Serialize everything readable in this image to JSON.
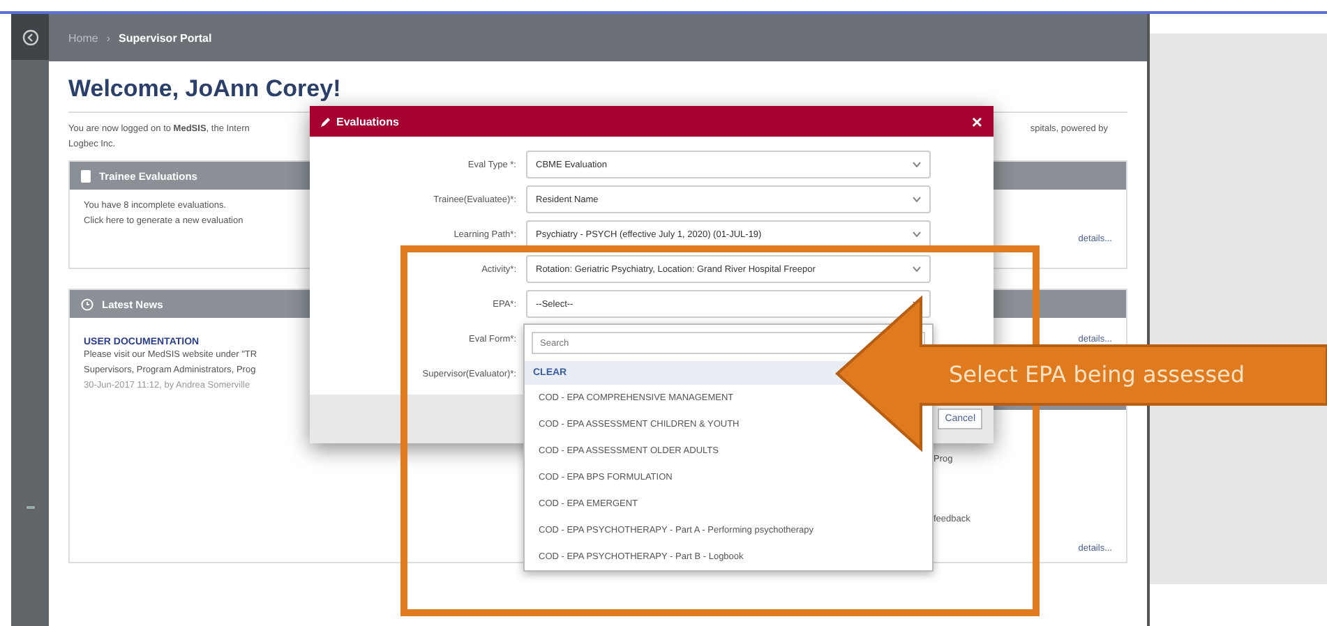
{
  "breadcrumb": [
    "Home",
    "Supervisor Portal"
  ],
  "breadcrumb_separator": "›",
  "welcome": "Welcome, JoAnn Corey!",
  "intro": {
    "left": "You are now logged on to **MedSIS**, the Intern",
    "right": "spitals, powered by",
    "second_line": "Logbec Inc."
  },
  "trainee_evaluations": {
    "title": "Trainee Evaluations",
    "lines": [
      "You have 8 incomplete evaluations.",
      "Click here to generate a new evaluation"
    ],
    "link": "details..."
  },
  "latest_news": {
    "title": "Latest News",
    "item_title": "USER DOCUMENTATION",
    "lines": [
      "Please visit our MedSIS website under \"TR",
      "Supervisors, Program Administrators, Prog"
    ],
    "meta": "30-Jun-2017 11:12, by Andrea Somerville",
    "right": [
      {
        "kind": "link",
        "text": "details..."
      },
      {
        "kind": "band"
      },
      {
        "kind": "text",
        "text": "Prog"
      },
      {
        "kind": "text",
        "text": "feedback"
      },
      {
        "kind": "link",
        "text": "details..."
      }
    ]
  },
  "modal": {
    "title": "Evaluations",
    "close": "×",
    "cancel": "Cancel",
    "fields": [
      {
        "label": "Eval Type *:",
        "value": "CBME Evaluation"
      },
      {
        "label": "Trainee(Evaluatee)*:",
        "value": "Resident Name"
      },
      {
        "label": "Learning Path*:",
        "value": "Psychiatry - PSYCH (effective July 1, 2020) (01-JUL-19)"
      },
      {
        "label": "Activity*:",
        "value": "Rotation: Geriatric Psychiatry, Location: Grand River Hospital Freepor"
      },
      {
        "label": "EPA*:",
        "value": "--Select--"
      },
      {
        "label": "Eval Form*:"
      },
      {
        "label": "Supervisor(Evaluator)*:"
      }
    ]
  },
  "dropdown": {
    "placeholder": "Search",
    "clear": "CLEAR",
    "options": [
      "COD - EPA COMPREHENSIVE MANAGEMENT",
      "COD - EPA ASSESSMENT CHILDREN & YOUTH",
      "COD - EPA ASSESSMENT OLDER ADULTS",
      "COD - EPA BPS FORMULATION",
      "COD - EPA EMERGENT",
      "COD - EPA PSYCHOTHERAPY - Part A - Performing psychotherapy",
      "COD - EPA PSYCHOTHERAPY - Part B - Logbook"
    ]
  },
  "callout": "Select EPA being assessed"
}
